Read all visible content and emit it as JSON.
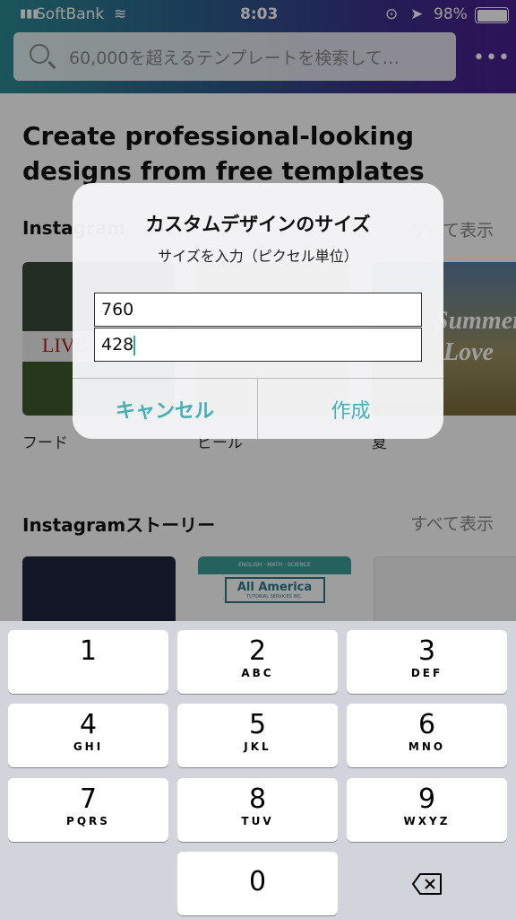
{
  "status": {
    "carrier": "SoftBank",
    "time": "8:03",
    "battery": "98%"
  },
  "search": {
    "placeholder": "60,000を超えるテンプレートを検索して…"
  },
  "main": {
    "headline": "Create professional-looking designs from free templates",
    "sections": [
      {
        "title": "Instagram",
        "see_all": "すべて表示",
        "items": [
          "フード",
          "ビール",
          "夏"
        ]
      },
      {
        "title": "Instagramストーリー",
        "see_all": "すべて表示",
        "items": []
      }
    ],
    "thumb_texts": {
      "live": "LIVE",
      "summer": "Summer",
      "love": "Love",
      "school_subjects": "ENGLISH · MATH · SCIENCE",
      "school_name": "All America",
      "school_sub": "TUTORIAL SERVICES INC."
    }
  },
  "dialog": {
    "title": "カスタムデザインのサイズ",
    "subtitle": "サイズを入力（ピクセル単位）",
    "width_value": "760",
    "height_value": "428",
    "cancel": "キャンセル",
    "create": "作成"
  },
  "keyboard": {
    "keys": [
      {
        "n": "1",
        "l": ""
      },
      {
        "n": "2",
        "l": "ABC"
      },
      {
        "n": "3",
        "l": "DEF"
      },
      {
        "n": "4",
        "l": "GHI"
      },
      {
        "n": "5",
        "l": "JKL"
      },
      {
        "n": "6",
        "l": "MNO"
      },
      {
        "n": "7",
        "l": "PQRS"
      },
      {
        "n": "8",
        "l": "TUV"
      },
      {
        "n": "9",
        "l": "WXYZ"
      },
      {
        "n": "0",
        "l": ""
      }
    ]
  },
  "colors": {
    "accent": "#45b0b8",
    "keyboard_bg": "#d1d4da"
  }
}
